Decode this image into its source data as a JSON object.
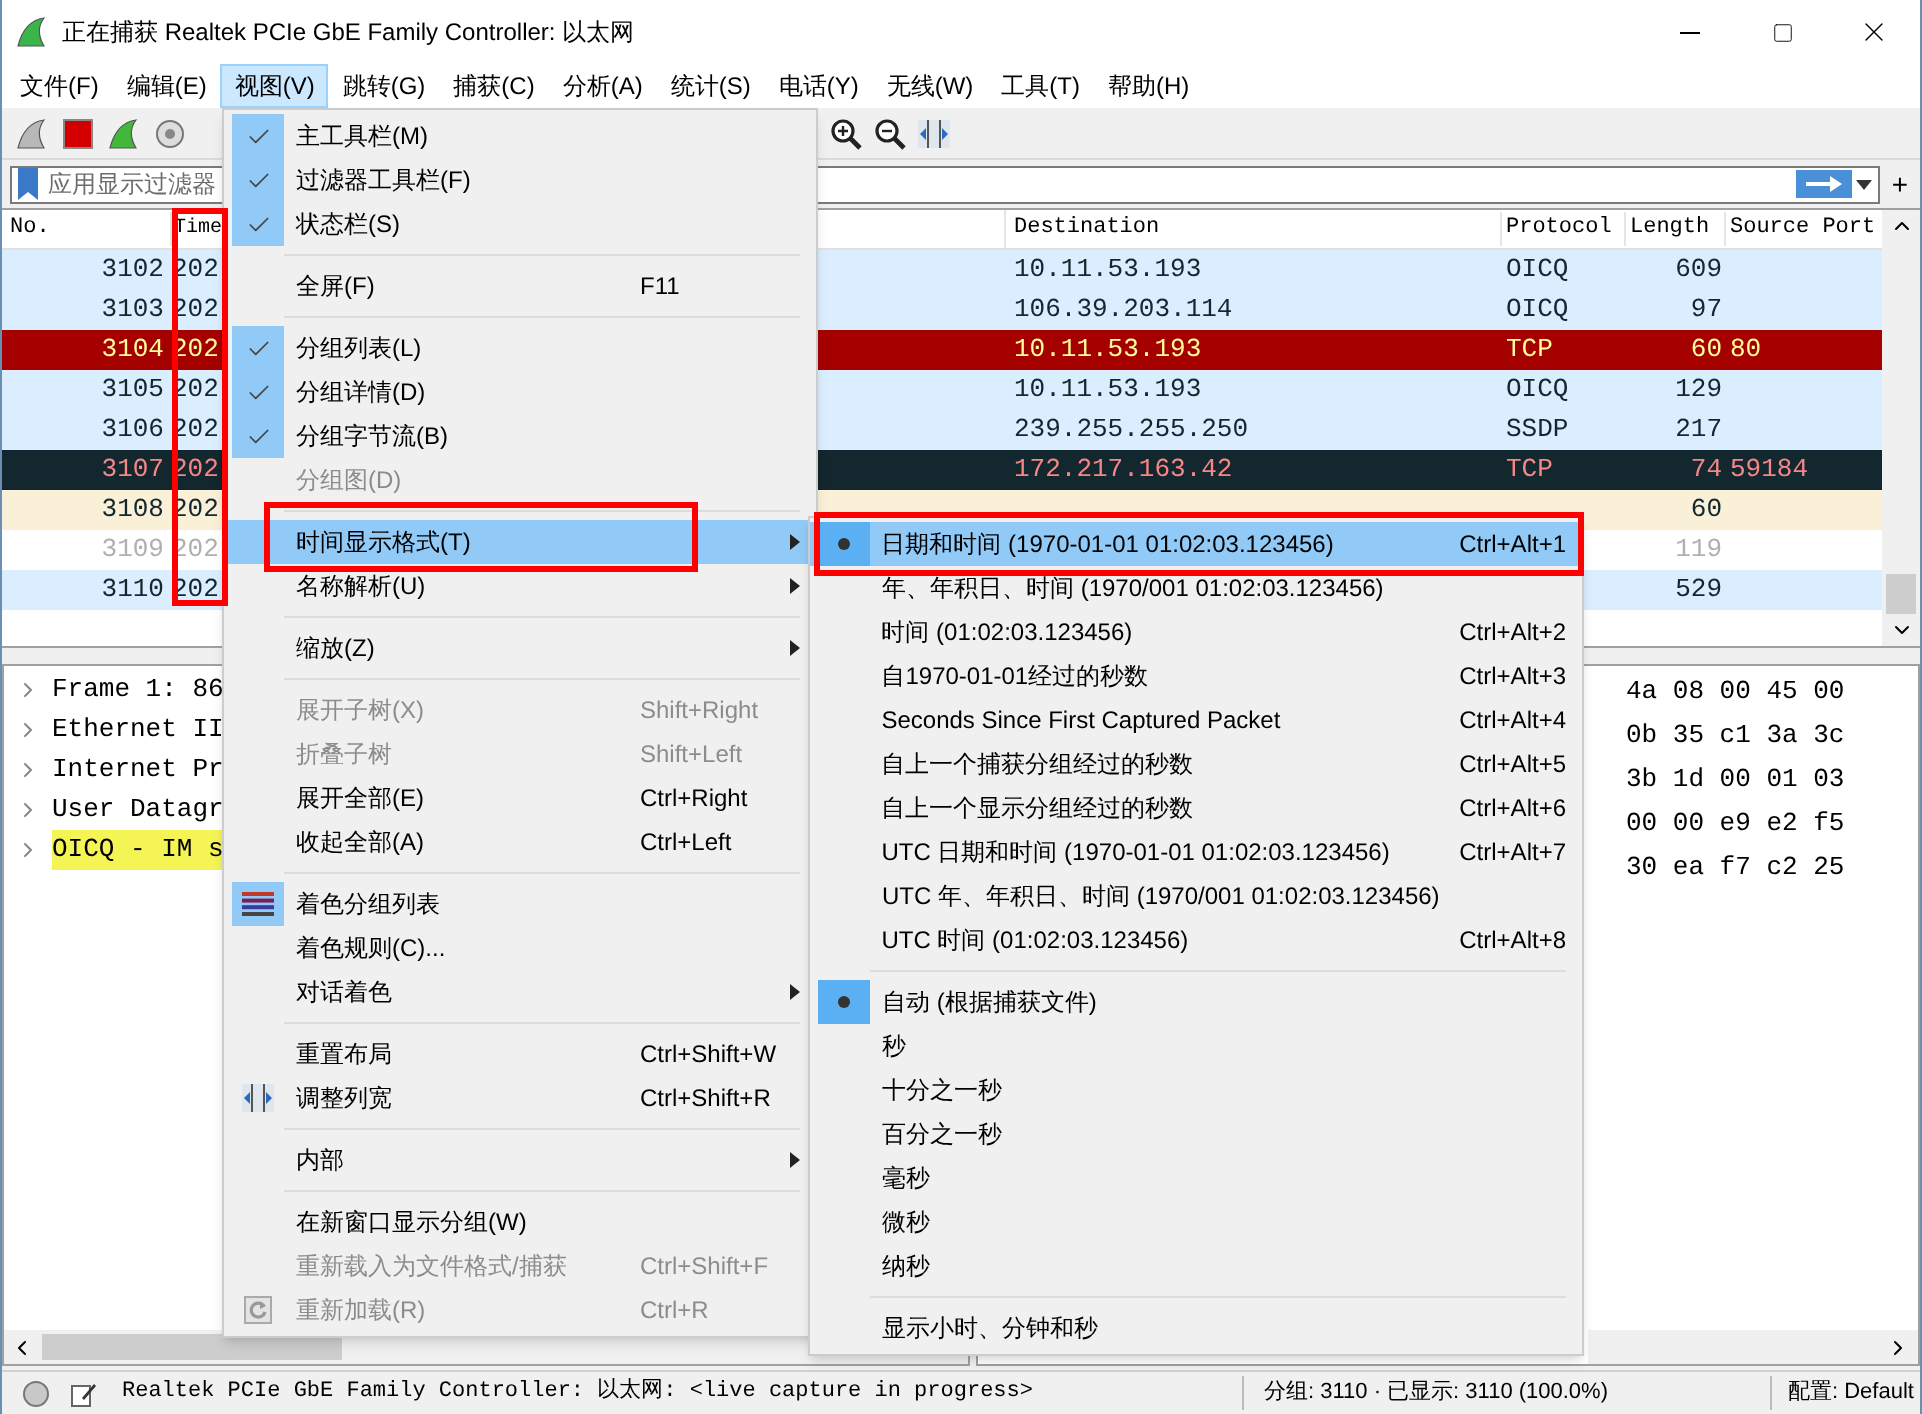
{
  "window": {
    "title": "正在捕获 Realtek PCIe GbE Family Controller: 以太网"
  },
  "menu_bar": [
    {
      "label": "文件(F)",
      "selected": false
    },
    {
      "label": "编辑(E)",
      "selected": false
    },
    {
      "label": "视图(V)",
      "selected": true
    },
    {
      "label": "跳转(G)",
      "selected": false
    },
    {
      "label": "捕获(C)",
      "selected": false
    },
    {
      "label": "分析(A)",
      "selected": false
    },
    {
      "label": "统计(S)",
      "selected": false
    },
    {
      "label": "电话(Y)",
      "selected": false
    },
    {
      "label": "无线(W)",
      "selected": false
    },
    {
      "label": "工具(T)",
      "selected": false
    },
    {
      "label": "帮助(H)",
      "selected": false
    }
  ],
  "filter_bar": {
    "placeholder": "应用显示过滤器",
    "add_label": "+"
  },
  "packet_list": {
    "columns": [
      "No.",
      "Time",
      "Destination",
      "Protocol",
      "Length",
      "Source Port"
    ],
    "rows": [
      {
        "no": "3102",
        "time": "202",
        "destination": "10.11.53.193",
        "protocol": "OICQ",
        "length": "609",
        "kind": "normal",
        "color": "#daeeff"
      },
      {
        "no": "3103",
        "time": "202",
        "destination": "106.39.203.114",
        "protocol": "OICQ",
        "length": "97",
        "kind": "normal",
        "color": "#daeeff"
      },
      {
        "no": "3104",
        "time": "202",
        "destination": "10.11.53.193",
        "protocol": "TCP",
        "length": "60",
        "source_port": "80",
        "kind": "alert",
        "color": "#a40000"
      },
      {
        "no": "3105",
        "time": "202",
        "destination": "10.11.53.193",
        "protocol": "OICQ",
        "length": "129",
        "kind": "normal",
        "color": "#daeeff"
      },
      {
        "no": "3106",
        "time": "202",
        "destination": "239.255.255.250",
        "protocol": "SSDP",
        "length": "217",
        "kind": "normal",
        "color": "#daeeff"
      },
      {
        "no": "3107",
        "time": "202",
        "destination": "172.217.163.42",
        "protocol": "TCP",
        "length": "74",
        "source_port": "59184",
        "kind": "dark",
        "color": "#12272e"
      },
      {
        "no": "3108",
        "time": "202",
        "length": "60",
        "kind": "normal",
        "color": "#faf0d7"
      },
      {
        "no": "3109",
        "time": "202",
        "length": "119",
        "kind": "muted",
        "color": "#ffffff"
      },
      {
        "no": "3110",
        "time": "202",
        "length": "529",
        "kind": "normal",
        "color": "#daeeff"
      }
    ]
  },
  "packet_details": [
    {
      "label": "Frame 1: 86",
      "expanded": false,
      "selected": false
    },
    {
      "label": "Ethernet II",
      "expanded": false,
      "selected": false
    },
    {
      "label": "Internet Pr",
      "expanded": false,
      "selected": false
    },
    {
      "label": "User Datagr",
      "expanded": false,
      "selected": false
    },
    {
      "label": "OICQ - IM s",
      "expanded": false,
      "selected": true
    }
  ],
  "packet_bytes": [
    "4a 08 00 45 00",
    "0b 35 c1 3a 3c",
    "3b 1d 00 01 03",
    "00 00 e9 e2 f5",
    "30 ea f7 c2 25"
  ],
  "view_menu": [
    {
      "kind": "check",
      "label": "主工具栏(M)",
      "checked": true,
      "disabled": false,
      "highlighted": false
    },
    {
      "kind": "check",
      "label": "过滤器工具栏(F)",
      "checked": true,
      "disabled": false,
      "highlighted": false
    },
    {
      "kind": "check",
      "label": "状态栏(S)",
      "checked": true,
      "disabled": false,
      "highlighted": false
    },
    {
      "kind": "separator"
    },
    {
      "kind": "check",
      "label": "全屏(F)",
      "shortcut": "F11",
      "checked": false,
      "disabled": false,
      "highlighted": false
    },
    {
      "kind": "separator"
    },
    {
      "kind": "check",
      "label": "分组列表(L)",
      "checked": true,
      "disabled": false,
      "highlighted": false
    },
    {
      "kind": "check",
      "label": "分组详情(D)",
      "checked": true,
      "disabled": false,
      "highlighted": false
    },
    {
      "kind": "check",
      "label": "分组字节流(B)",
      "checked": true,
      "disabled": false,
      "highlighted": false
    },
    {
      "kind": "check",
      "label": "分组图(D)",
      "checked": false,
      "disabled": true,
      "highlighted": false
    },
    {
      "kind": "separator"
    },
    {
      "kind": "submenu",
      "label": "时间显示格式(T)",
      "disabled": false,
      "highlighted": true
    },
    {
      "kind": "submenu",
      "label": "名称解析(U)",
      "disabled": false,
      "highlighted": false
    },
    {
      "kind": "separator"
    },
    {
      "kind": "submenu",
      "label": "缩放(Z)",
      "disabled": false,
      "highlighted": false
    },
    {
      "kind": "separator"
    },
    {
      "kind": "plain",
      "label": "展开子树(X)",
      "shortcut": "Shift+Right",
      "disabled": true,
      "highlighted": false
    },
    {
      "kind": "plain",
      "label": "折叠子树",
      "shortcut": "Shift+Left",
      "disabled": true,
      "highlighted": false
    },
    {
      "kind": "plain",
      "label": "展开全部(E)",
      "shortcut": "Ctrl+Right",
      "disabled": false,
      "highlighted": false
    },
    {
      "kind": "plain",
      "label": "收起全部(A)",
      "shortcut": "Ctrl+Left",
      "disabled": false,
      "highlighted": false
    },
    {
      "kind": "separator"
    },
    {
      "kind": "colorize",
      "label": "着色分组列表",
      "checked": true,
      "disabled": false,
      "highlighted": false
    },
    {
      "kind": "plain",
      "label": "着色规则(C)...",
      "disabled": false,
      "highlighted": false
    },
    {
      "kind": "submenu",
      "label": "对话着色",
      "disabled": false,
      "highlighted": false
    },
    {
      "kind": "separator"
    },
    {
      "kind": "plain",
      "label": "重置布局",
      "shortcut": "Ctrl+Shift+W",
      "disabled": false,
      "highlighted": false
    },
    {
      "kind": "resize",
      "label": "调整列宽",
      "shortcut": "Ctrl+Shift+R",
      "disabled": false,
      "highlighted": false
    },
    {
      "kind": "separator"
    },
    {
      "kind": "submenu",
      "label": "内部",
      "disabled": false,
      "highlighted": false
    },
    {
      "kind": "separator"
    },
    {
      "kind": "plain",
      "label": "在新窗口显示分组(W)",
      "disabled": false,
      "highlighted": false
    },
    {
      "kind": "plain",
      "label": "重新载入为文件格式/捕获",
      "shortcut": "Ctrl+Shift+F",
      "disabled": true,
      "highlighted": false
    },
    {
      "kind": "reload",
      "label": "重新加载(R)",
      "shortcut": "Ctrl+R",
      "disabled": true,
      "highlighted": false
    }
  ],
  "time_format_menu": [
    {
      "kind": "radio",
      "label": "日期和时间 (1970-01-01 01:02:03.123456)",
      "shortcut": "Ctrl+Alt+1",
      "selected": true,
      "highlighted": true
    },
    {
      "kind": "radio",
      "label": "年、年积日、时间 (1970/001 01:02:03.123456)",
      "selected": false,
      "highlighted": false
    },
    {
      "kind": "radio",
      "label": "时间 (01:02:03.123456)",
      "shortcut": "Ctrl+Alt+2",
      "selected": false,
      "highlighted": false
    },
    {
      "kind": "radio",
      "label": "自1970-01-01经过的秒数",
      "shortcut": "Ctrl+Alt+3",
      "selected": false,
      "highlighted": false
    },
    {
      "kind": "radio",
      "label": "Seconds Since First Captured Packet",
      "shortcut": "Ctrl+Alt+4",
      "selected": false,
      "highlighted": false
    },
    {
      "kind": "radio",
      "label": "自上一个捕获分组经过的秒数",
      "shortcut": "Ctrl+Alt+5",
      "selected": false,
      "highlighted": false
    },
    {
      "kind": "radio",
      "label": "自上一个显示分组经过的秒数",
      "shortcut": "Ctrl+Alt+6",
      "selected": false,
      "highlighted": false
    },
    {
      "kind": "radio",
      "label": "UTC 日期和时间 (1970-01-01 01:02:03.123456)",
      "shortcut": "Ctrl+Alt+7",
      "selected": false,
      "highlighted": false
    },
    {
      "kind": "radio",
      "label": "UTC 年、年积日、时间 (1970/001 01:02:03.123456)",
      "selected": false,
      "highlighted": false
    },
    {
      "kind": "radio",
      "label": "UTC 时间 (01:02:03.123456)",
      "shortcut": "Ctrl+Alt+8",
      "selected": false,
      "highlighted": false
    },
    {
      "kind": "separator"
    },
    {
      "kind": "radio",
      "label": "自动 (根据捕获文件)",
      "selected": true,
      "highlighted": false
    },
    {
      "kind": "radio",
      "label": "秒",
      "selected": false,
      "highlighted": false
    },
    {
      "kind": "radio",
      "label": "十分之一秒",
      "selected": false,
      "highlighted": false
    },
    {
      "kind": "radio",
      "label": "百分之一秒",
      "selected": false,
      "highlighted": false
    },
    {
      "kind": "radio",
      "label": "毫秒",
      "selected": false,
      "highlighted": false
    },
    {
      "kind": "radio",
      "label": "微秒",
      "selected": false,
      "highlighted": false
    },
    {
      "kind": "radio",
      "label": "纳秒",
      "selected": false,
      "highlighted": false
    },
    {
      "kind": "separator"
    },
    {
      "kind": "check",
      "label": "显示小时、分钟和秒",
      "checked": false,
      "highlighted": false
    }
  ],
  "status_bar": {
    "interface": "Realtek PCIe GbE Family Controller: 以太网: <live capture in progress>",
    "packets": "分组: 3110 · 已显示: 3110 (100.0%)",
    "profile": "配置: Default"
  }
}
